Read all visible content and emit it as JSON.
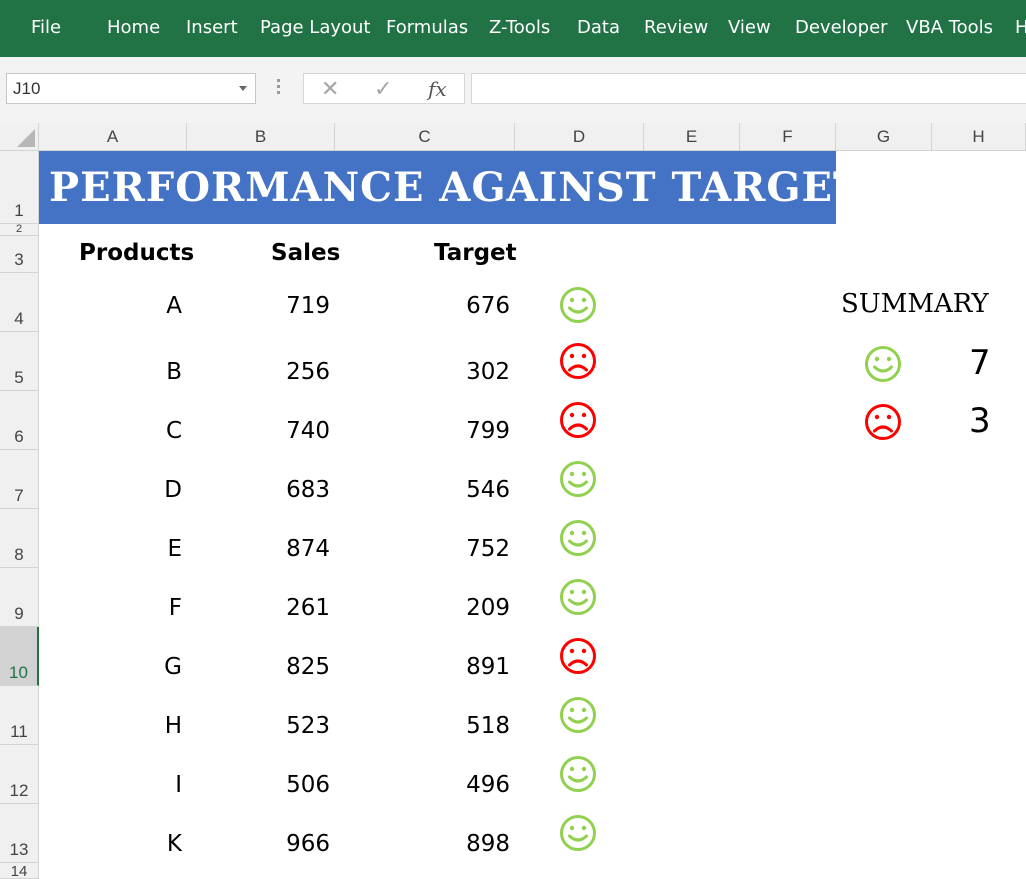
{
  "ribbon": {
    "tabs": [
      "File",
      "Home",
      "Insert",
      "Page Layout",
      "Formulas",
      "Z-Tools",
      "Data",
      "Review",
      "View",
      "Developer",
      "VBA Tools",
      "H"
    ]
  },
  "formula_bar": {
    "name_box": "J10",
    "fx_label": "fx",
    "cancel_glyph": "✕",
    "enter_glyph": "✓",
    "formula": ""
  },
  "columns": [
    "A",
    "B",
    "C",
    "D",
    "E",
    "F",
    "G",
    "H"
  ],
  "rows": [
    "1",
    "2",
    "3",
    "4",
    "5",
    "6",
    "7",
    "8",
    "9",
    "10",
    "11",
    "12",
    "13",
    "14"
  ],
  "selected_row": "10",
  "sheet": {
    "title": "PERFORMANCE AGAINST TARGET",
    "headers": {
      "products": "Products",
      "sales": "Sales",
      "target": "Target"
    },
    "records": [
      {
        "product": "A",
        "sales": "719",
        "target": "676",
        "status": "happy"
      },
      {
        "product": "B",
        "sales": "256",
        "target": "302",
        "status": "sad"
      },
      {
        "product": "C",
        "sales": "740",
        "target": "799",
        "status": "sad"
      },
      {
        "product": "D",
        "sales": "683",
        "target": "546",
        "status": "happy"
      },
      {
        "product": "E",
        "sales": "874",
        "target": "752",
        "status": "happy"
      },
      {
        "product": "F",
        "sales": "261",
        "target": "209",
        "status": "happy"
      },
      {
        "product": "G",
        "sales": "825",
        "target": "891",
        "status": "sad"
      },
      {
        "product": "H",
        "sales": "523",
        "target": "518",
        "status": "happy"
      },
      {
        "product": "I",
        "sales": "506",
        "target": "496",
        "status": "happy"
      },
      {
        "product": "K",
        "sales": "966",
        "target": "898",
        "status": "happy"
      }
    ],
    "summary": {
      "title": "SUMMARY",
      "happy_count": "7",
      "sad_count": "3"
    }
  },
  "colors": {
    "ribbon": "#217346",
    "title_fill": "#4472c4",
    "happy": "#92d050",
    "sad": "#ff0000"
  },
  "icons": {
    "happy": "smiley-face-icon",
    "sad": "frowning-face-icon"
  }
}
